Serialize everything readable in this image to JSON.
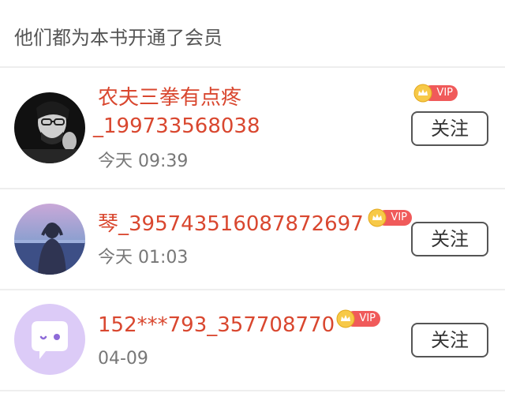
{
  "header": {
    "title": "他们都为本书开通了会员"
  },
  "accent_color": "#d9472f",
  "vip_color": "#f05a5a",
  "members": [
    {
      "name_line1": "农夫三拳有点疼",
      "name_line2": "_199733568038",
      "time": "今天 09:39",
      "badge": "VIP",
      "follow_label": "关注",
      "avatar": "dark-portrait-avatar"
    },
    {
      "name_line1": "琴_395743516087872697",
      "time": "今天 01:03",
      "badge": "VIP",
      "follow_label": "关注",
      "avatar": "lakeside-photo-avatar"
    },
    {
      "name_line1": "152***793_357708770",
      "time": "04-09",
      "badge": "VIP",
      "follow_label": "关注",
      "avatar": "chat-bubble-avatar"
    }
  ]
}
